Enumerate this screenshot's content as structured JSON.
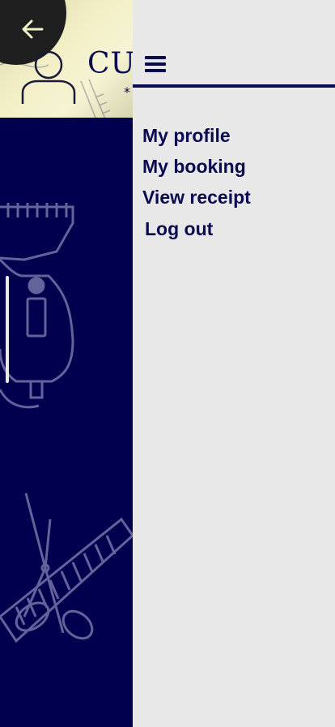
{
  "header": {
    "brand_text": "CU",
    "brand_sub": "*"
  },
  "icons": {
    "back": "arrow-left-icon",
    "avatar": "user-avatar-icon",
    "menu": "hamburger-menu-icon"
  },
  "colors": {
    "navy": "#00004f",
    "drawer_bg": "#e8e8e8",
    "accent_text": "#0a0a50",
    "back_button": "#1f1f1f"
  },
  "drawer": {
    "menu_items": [
      {
        "label": "My profile"
      },
      {
        "label": "My booking"
      },
      {
        "label": "View receipt"
      },
      {
        "label": "Log out"
      }
    ]
  }
}
